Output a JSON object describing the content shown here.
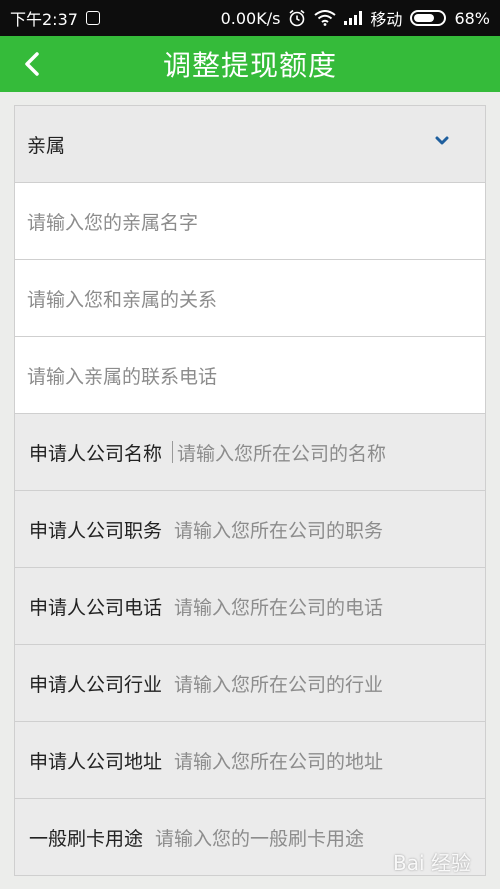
{
  "status_bar": {
    "time": "下午2:37",
    "speed": "0.00K/s",
    "carrier": "移动",
    "battery": "68%"
  },
  "header": {
    "title": "调整提现额度"
  },
  "form": {
    "relative_select": {
      "label": "亲属"
    },
    "relative_name": {
      "placeholder": "请输入您的亲属名字"
    },
    "relationship": {
      "placeholder": "请输入您和亲属的关系"
    },
    "relative_phone": {
      "placeholder": "请输入亲属的联系电话"
    },
    "company_name": {
      "label": "申请人公司名称",
      "placeholder": "请输入您所在公司的名称"
    },
    "company_position": {
      "label": "申请人公司职务",
      "placeholder": "请输入您所在公司的职务"
    },
    "company_phone": {
      "label": "申请人公司电话",
      "placeholder": "请输入您所在公司的电话"
    },
    "company_industry": {
      "label": "申请人公司行业",
      "placeholder": "请输入您所在公司的行业"
    },
    "company_address": {
      "label": "申请人公司地址",
      "placeholder": "请输入您所在公司的地址"
    },
    "card_usage": {
      "label": "一般刷卡用途",
      "placeholder": "请输入您的一般刷卡用途"
    }
  },
  "icons": {
    "back": "chevron-left-icon",
    "dropdown": "chevron-down-icon",
    "accent_color": "#35bb3a",
    "chevron_color": "#1f5f9e"
  }
}
